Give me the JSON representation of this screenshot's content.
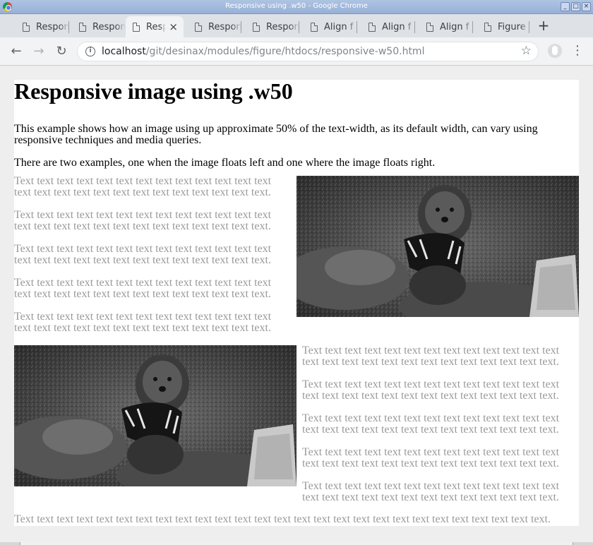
{
  "window": {
    "title": "Responsive using .w50 - Google Chrome",
    "buttons": [
      "_",
      "□",
      "×"
    ]
  },
  "tabs": [
    {
      "label": "Respon",
      "active": false
    },
    {
      "label": "Respon",
      "active": false
    },
    {
      "label": "Respon",
      "active": true
    },
    {
      "label": "Respon",
      "active": false
    },
    {
      "label": "Respon",
      "active": false
    },
    {
      "label": "Align f",
      "active": false
    },
    {
      "label": "Align f",
      "active": false
    },
    {
      "label": "Align f",
      "active": false
    },
    {
      "label": "Figure",
      "active": false
    }
  ],
  "toolbar": {
    "back_icon": "←",
    "forward_icon": "→",
    "reload_icon": "↻",
    "new_tab_icon": "+",
    "url_host": "localhost",
    "url_path": "/git/desinax/modules/figure/htdocs/responsive-w50.html",
    "star_icon": "☆",
    "menu_icon": "⋮"
  },
  "page": {
    "heading": "Responsive image using .w50",
    "intro": "This example shows how an image using up approximate 50% of the text-width, as its default width, can vary using responsive techniques and media queries.",
    "intro2": "There are two examples, one when the image floats left and one where the image floats right.",
    "paragraph": "Text text text text text text text text text text text text text text text text text text text text text text text text text text.",
    "footer_paragraph": "Text text text text text text text text text text text text text text text text text text text text text text text text text text text.",
    "image_alt": "Black and white photo of a poodle in a harness sitting on rocks"
  },
  "colors": {
    "muted_text": "#999999",
    "tab_strip": "#dee1e6",
    "toolbar": "#f1f3f4"
  }
}
